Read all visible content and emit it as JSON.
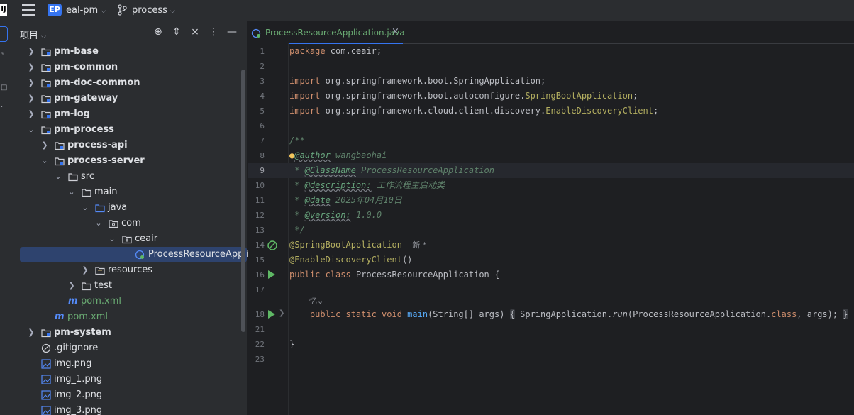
{
  "titlebar": {
    "app_icon": "IJ",
    "project_badge": "EP",
    "project_name": "eal-pm",
    "branch": "process"
  },
  "project_panel": {
    "title": "项目",
    "tree": [
      {
        "label": "pm-base",
        "bold": true
      },
      {
        "label": "pm-common",
        "bold": true
      },
      {
        "label": "pm-doc-common",
        "bold": true
      },
      {
        "label": "pm-gateway",
        "bold": true
      },
      {
        "label": "pm-log",
        "bold": true
      },
      {
        "label": "pm-process",
        "bold": true
      },
      {
        "label": "process-api",
        "bold": true
      },
      {
        "label": "process-server",
        "bold": true
      },
      {
        "label": "src"
      },
      {
        "label": "main"
      },
      {
        "label": "java"
      },
      {
        "label": "com"
      },
      {
        "label": "ceair"
      },
      {
        "label": "ProcessResourceApplication"
      },
      {
        "label": "resources"
      },
      {
        "label": "test"
      },
      {
        "label": "pom.xml"
      },
      {
        "label": "pom.xml"
      },
      {
        "label": "pm-system",
        "bold": true
      },
      {
        "label": ".gitignore"
      },
      {
        "label": "img.png"
      },
      {
        "label": "img_1.png"
      },
      {
        "label": "img_2.png"
      },
      {
        "label": "img_3.png"
      }
    ]
  },
  "editor": {
    "tab_title": "ProcessResourceApplication.java",
    "line_numbers": [
      "1",
      "2",
      "3",
      "4",
      "5",
      "6",
      "7",
      "8",
      "9",
      "10",
      "11",
      "12",
      "13",
      "14",
      "15",
      "16",
      "17",
      "18",
      "21",
      "22",
      "23"
    ],
    "code": {
      "l1_kw": "package",
      "l1_rest": " com.ceair;",
      "l3_kw": "import",
      "l3_rest": " org.springframework.boot.SpringApplication;",
      "l4_kw": "import",
      "l4_rest": " org.springframework.boot.autoconfigure.",
      "l4_ann": "SpringBootApplication",
      "l4_end": ";",
      "l5_kw": "import",
      "l5_rest": " org.springframework.cloud.client.discovery.",
      "l5_ann": "EnableDiscoveryClient",
      "l5_end": ";",
      "l7": "/**",
      "l8_tag": "@author",
      "l8_text": " wangbaohai",
      "l9_star": " * ",
      "l9_tag": "@ClassName",
      "l9_text": " ProcessResourceApplication",
      "l10_star": " * ",
      "l10_tag": "@description:",
      "l10_text": " 工作流程主启动类",
      "l11_star": " * ",
      "l11_tag": "@date",
      "l11_text": " 2025年04月10日",
      "l12_star": " * ",
      "l12_tag": "@version:",
      "l12_text": " 1.0.0",
      "l13": " */",
      "l14_ann": "@SpringBootApplication",
      "l14_hint": "新 *",
      "l15_ann": "@EnableDiscoveryClient",
      "l15_rest": "()",
      "l16_kw": "public class",
      "l16_rest": " ProcessResourceApplication {",
      "l17_hint": "忆⌄",
      "l18_indent": "    ",
      "l18_kw": "public static void",
      "l18_fn": " main",
      "l18_rest": "(String[] args) ",
      "l18_fold_open": "{",
      "l18_body": " SpringApplication.",
      "l18_run": "run",
      "l18_args": "(ProcessResourceApplication.",
      "l18_class": "class",
      "l18_end": ", args);",
      "l18_fold_close": "}",
      "l22": "}"
    }
  }
}
